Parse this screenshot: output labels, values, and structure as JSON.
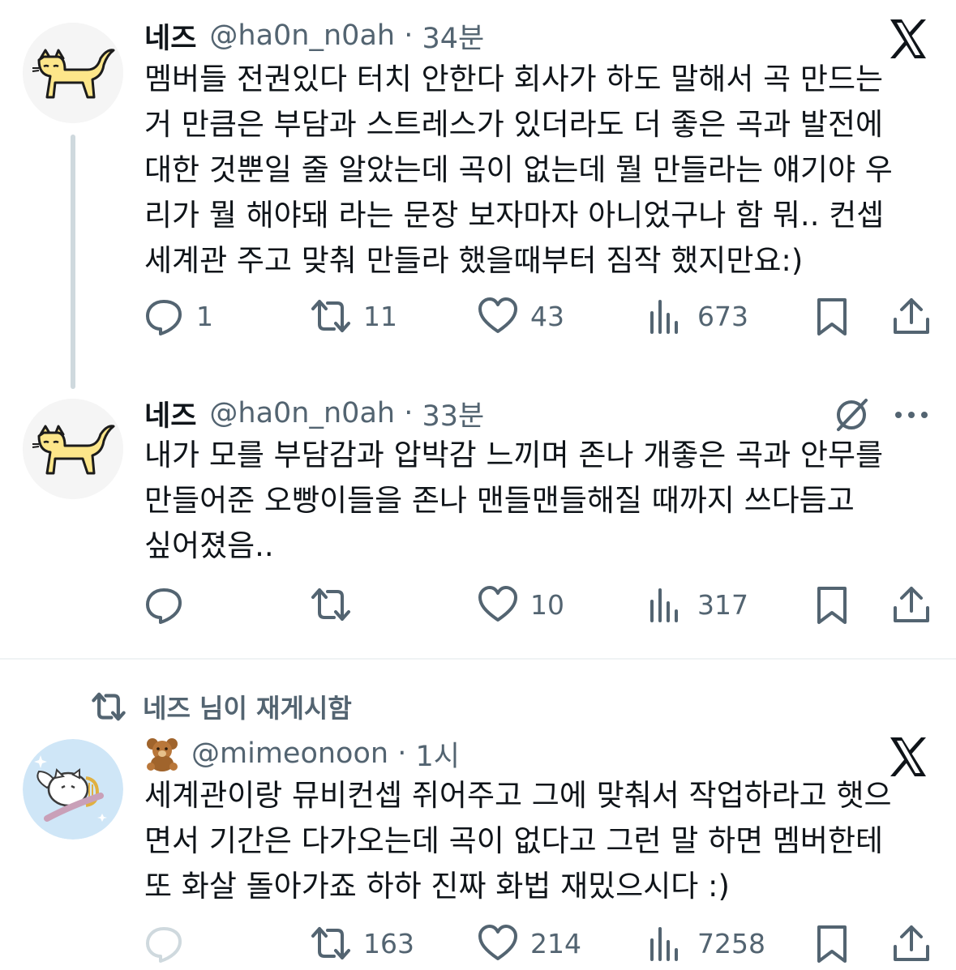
{
  "tweets": [
    {
      "name": "네즈",
      "handle": "@ha0n_n0ah",
      "time": "34분",
      "body": [
        "멤버들 전권있다 터치 안한다 회사가 하도 말해서 곡 만드는",
        "거 만큼은 부담과 스트레스가 있더라도 더 좋은 곡과 발전에",
        "대한 것뿐일 줄 알았는데 곡이 없는데 뭘 만들라는 얘기야 우",
        "리가 뭘 해야돼 라는 문장 보자마자 아니었구나 함 뭐.. 컨셉",
        "세계관 주고 맞춰 만들라 했을때부터 짐작 했지만요:)"
      ],
      "replies": "1",
      "retweets": "11",
      "likes": "43",
      "views": "673",
      "corner_icon": "x-logo"
    },
    {
      "name": "네즈",
      "handle": "@ha0n_n0ah",
      "time": "33분",
      "body": [
        "내가 모를 부담감과 압박감 느끼며 존나 개좋은 곡과 안무를",
        "만들어준 오빵이들을 존나 맨들맨들해질 때까지 쓰다듬고",
        "싶어졌음.."
      ],
      "replies": "",
      "retweets": "",
      "likes": "10",
      "views": "317",
      "corner_icon": "grok-icon"
    },
    {
      "retweet_banner": "네즈 님이 재게시함",
      "name_emoji": "🧸",
      "handle": "@mimeonoon",
      "time": "1시",
      "body": [
        "세계관이랑 뮤비컨셉 쥐어주고 그에 맞춰서 작업하라고 햇으",
        "면서 기간은 다가오는데 곡이 없다고 그런 말 하면 멤버한테",
        "또 화살 돌아가죠 하하 진짜 화법 재밌으시다 :)"
      ],
      "replies": "",
      "retweets": "163",
      "likes": "214",
      "views": "7258",
      "corner_icon": "x-logo"
    }
  ],
  "colors": {
    "text": "#0f1419",
    "secondary": "#536471",
    "divider": "#eff3f4",
    "thread_line": "#cfd9de",
    "cat_fill": "#fde68a"
  }
}
